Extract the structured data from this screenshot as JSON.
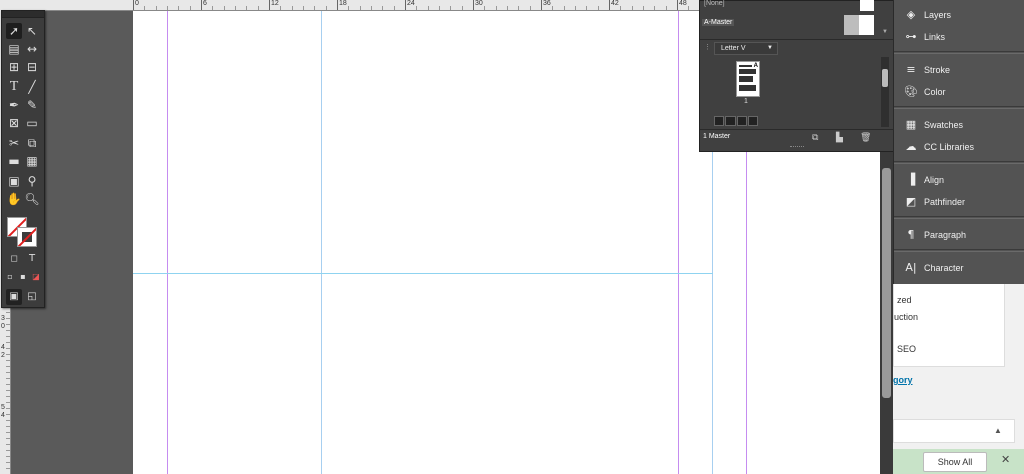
{
  "ruler": {
    "top_labels": [
      "0",
      "6",
      "12",
      "18",
      "24",
      "30",
      "36",
      "42",
      "48"
    ],
    "left_labels": [
      "3",
      "0",
      "4",
      "2",
      "5",
      "4"
    ]
  },
  "pages_panel": {
    "none_label": "[None]",
    "master_label": "A-Master",
    "page_size_select": "Letter V",
    "page_number": "1",
    "master_count": "1 Master"
  },
  "right_panels": {
    "items": [
      {
        "label": "Layers",
        "icon": "layers-icon"
      },
      {
        "label": "Links",
        "icon": "links-icon"
      },
      {
        "label": "Stroke",
        "icon": "stroke-icon"
      },
      {
        "label": "Color",
        "icon": "color-icon"
      },
      {
        "label": "Swatches",
        "icon": "swatches-icon"
      },
      {
        "label": "CC Libraries",
        "icon": "cc-libraries-icon"
      },
      {
        "label": "Align",
        "icon": "align-icon"
      },
      {
        "label": "Pathfinder",
        "icon": "pathfinder-icon"
      },
      {
        "label": "Paragraph",
        "icon": "paragraph-icon"
      },
      {
        "label": "Character",
        "icon": "character-icon"
      }
    ]
  },
  "web": {
    "line1": "zed",
    "line2": "uction",
    "line3": "SEO",
    "link": "gory",
    "show_all": "Show All",
    "close": "✕"
  },
  "colors": {
    "guide_margin": "#c58cf0",
    "guide_column": "#8fd3f0",
    "panel_bg": "#535353",
    "toolbar_bg": "#3c3c3c"
  }
}
